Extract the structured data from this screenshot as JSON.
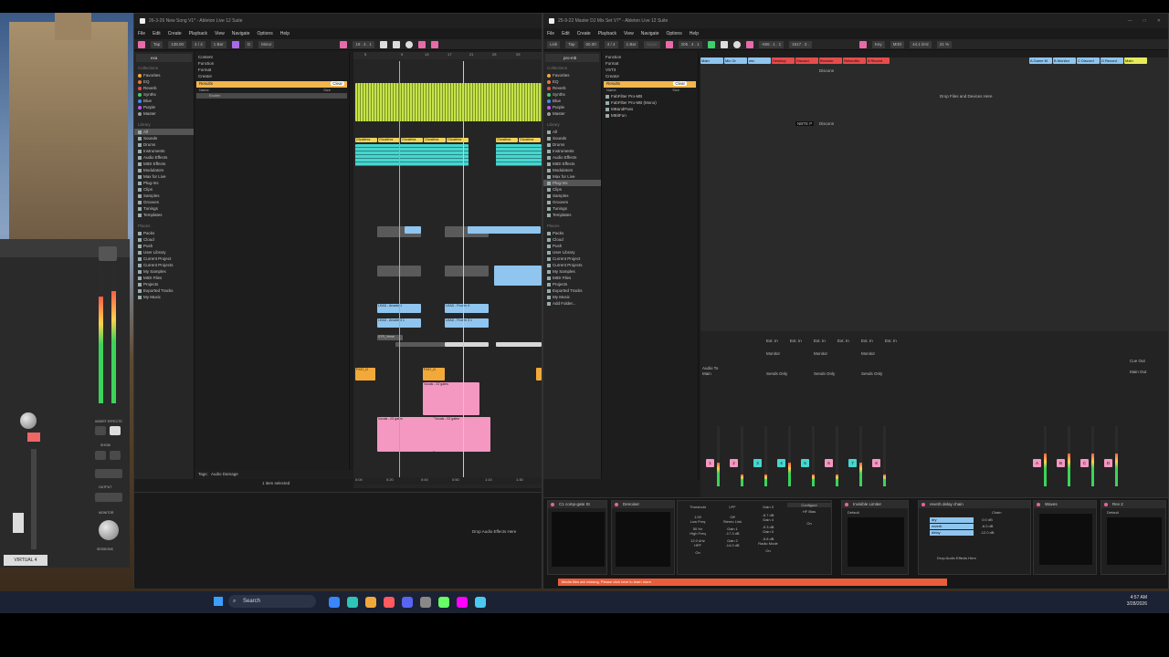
{
  "left_app": {
    "title": "26-3-26 New Song V1* - Ableton Live 12 Suite",
    "menu": [
      "File",
      "Edit",
      "Create",
      "Playback",
      "View",
      "Navigate",
      "Options",
      "Help"
    ],
    "toolbar": {
      "tap": "Tap",
      "bpm": "138.00",
      "signature": "4 / 4",
      "quant": "1 Bar",
      "key": "G",
      "scale": "Minor",
      "position": "19 . 4 . 1"
    },
    "search": {
      "value": "exa"
    },
    "filters": [
      "Content",
      "Function",
      "Format",
      "Creator"
    ],
    "results_header": "Results",
    "clear_label": "Clear",
    "name_col": "Name",
    "size_col": "Size",
    "result_item": "Exciter",
    "collections_title": "Collections",
    "collections": [
      {
        "label": "Favorites",
        "color": "#f2a93a"
      },
      {
        "label": "EQ",
        "color": "#e87a2e"
      },
      {
        "label": "Reverb",
        "color": "#e84b4b"
      },
      {
        "label": "Synths",
        "color": "#45c96c"
      },
      {
        "label": "Blue",
        "color": "#3d8fef"
      },
      {
        "label": "Purple",
        "color": "#b55be9"
      },
      {
        "label": "Master",
        "color": "#9a9a9a"
      }
    ],
    "library_title": "Library",
    "library": [
      "All",
      "Sounds",
      "Drums",
      "Instruments",
      "Audio Effects",
      "MIDI Effects",
      "Modulators",
      "Max for Live",
      "Plug-Ins",
      "Clips",
      "Samples",
      "Grooves",
      "Tunings",
      "Templates"
    ],
    "places_title": "Places",
    "places": [
      "Packs",
      "Cloud",
      "Push",
      "User Library",
      "Current Project",
      "Current Projects",
      "My Samples",
      "MIDI Files",
      "Projects",
      "Exported Tracks",
      "My Music"
    ],
    "ruler_marks": [
      "5",
      "9",
      "13",
      "17",
      "21",
      "25",
      "29"
    ],
    "time_marks": [
      "0:00",
      "0:20",
      "0:40",
      "0:50",
      "1:10",
      "1:30",
      "1:50"
    ],
    "clips": {
      "ghost": "Ghostfrea",
      "lead_a": "LEAD - Arcade 1",
      "lead_b": "LEAD - Frozen 3",
      "lead_c": "LEAD - Arcade 3 1",
      "lead_d": "LEAD - Frozen 3 1",
      "strings": "STR_Verse",
      "fx": "FX47_G",
      "vox1": "Vocals - 02 gates",
      "vox2": "Vocals - 02 gates",
      "vox3": "Vocals - 02 gates"
    },
    "tags": {
      "label": "Tags:",
      "value": "Audio Damage"
    },
    "status": "1 item selected"
  },
  "right_app": {
    "title": "25-9-22 Master DJ Mix Set V7* - Ableton Live 12 Suite",
    "menu": [
      "File",
      "Edit",
      "Create",
      "Playback",
      "View",
      "Navigate",
      "Options",
      "Help"
    ],
    "toolbar": {
      "link": "Link",
      "tap": "Tap",
      "bpm": "60.00",
      "signature": "4 / 4",
      "quant": "1 Bar",
      "key_mode": "Major",
      "position": "205 . 4 . 1",
      "pos2": "-655 . 1 . 1",
      "pos3": "1517 . 3 .",
      "key": "Key",
      "midi": "MIDI",
      "sample_rate": "44.1 kHz",
      "cpu": "21 %"
    },
    "search": {
      "value": "pro-mb"
    },
    "filters": [
      "Function",
      "Format",
      "VST3",
      "Creator"
    ],
    "results_header": "Results",
    "clear_label": "Clear",
    "name_col": "Name",
    "size_col": "Size",
    "results": [
      "FabFilter Pro-MB",
      "FabFilter Pro-MB (Mono)",
      "MBandPass",
      "MBitFun"
    ],
    "collections_title": "Collections",
    "collections": [
      {
        "label": "Favorites",
        "color": "#f2a93a"
      },
      {
        "label": "EQ",
        "color": "#e87a2e"
      },
      {
        "label": "Reverb",
        "color": "#e84b4b"
      },
      {
        "label": "Synths",
        "color": "#45c96c"
      },
      {
        "label": "Blue",
        "color": "#3d8fef"
      },
      {
        "label": "Purple",
        "color": "#b55be9"
      },
      {
        "label": "Master",
        "color": "#9a9a9a"
      }
    ],
    "library_title": "Library",
    "library": [
      "All",
      "Sounds",
      "Drums",
      "Instruments",
      "Audio Effects",
      "MIDI Effects",
      "Modulators",
      "Max for Live",
      "Plug-Ins",
      "Clips",
      "Samples",
      "Grooves",
      "Tunings",
      "Templates"
    ],
    "places_title": "Places",
    "places": [
      "Packs",
      "Cloud",
      "Push",
      "User Library",
      "Current Project",
      "Current Projects",
      "My Samples",
      "MIDI Files",
      "Projects",
      "Exported Tracks",
      "My Music",
      "Add Folder..."
    ],
    "tracks": [
      {
        "name": "Main",
        "color": "#8fc5ee"
      },
      {
        "name": "Mix Gr",
        "color": "#8fc5ee"
      },
      {
        "name": "mic",
        "color": "#8fc5ee"
      },
      {
        "name": "Desktop",
        "color": "#e84b4b"
      },
      {
        "name": "Discord",
        "color": "#e84b4b"
      },
      {
        "name": "Browser",
        "color": "#e84b4b"
      },
      {
        "name": "Rekordbo",
        "color": "#e84b4b"
      },
      {
        "name": "8 Record",
        "color": "#e84b4b"
      }
    ],
    "return_tracks": [
      {
        "name": "A Game M",
        "color": "#8fc5ee"
      },
      {
        "name": "B Monitor",
        "color": "#8fc5ee"
      },
      {
        "name": "C Discord",
        "color": "#8fc5ee"
      },
      {
        "name": "D Record",
        "color": "#8fc5ee"
      },
      {
        "name": "Main",
        "color": "#e7ea5c"
      }
    ],
    "clip_slot_text": {
      "disconn": "Disconn",
      "nbte": "NBTE P"
    },
    "drop_hint": "Drop Files and Devices Here",
    "channel_numbers": [
      "1",
      "2",
      "3",
      "4",
      "5",
      "6",
      "7",
      "8"
    ],
    "return_letters": [
      "A",
      "B",
      "C",
      "D"
    ],
    "io": {
      "audio_to": "Audio To",
      "main": "Main",
      "ext_in": "Ext. In",
      "sends_only": "Sends Only",
      "monitor": "Monitor",
      "in": "In",
      "auto": "Auto",
      "off": "Off",
      "cue_out": "Cue Out",
      "main_out": "Main Out",
      "io_12": "1/2"
    },
    "devices": [
      {
        "name": "C1 comp-gate St"
      },
      {
        "name": "Denoiser"
      },
      {
        "name": "Invisible Limiter"
      },
      {
        "name": "reverb delay chain"
      },
      {
        "name": "Waves"
      },
      {
        "name": "Rev 2"
      }
    ],
    "denoiser_params": {
      "threshold": "Threshold",
      "t_val": "1.00",
      "low_freq": "Low Freq",
      "lf_val": "50 Hz",
      "high_freq": "High Freq",
      "hf_val": "12.0 kHz",
      "hpf": "HPF",
      "off": "Off",
      "stereo_link": "Stereo Link",
      "lpf": "LPF",
      "gain1": "Gain 1",
      "g1": "-17.3 dB",
      "gain2": "Gain 2",
      "g2": "-14.0 dB",
      "gain3": "Gain 3",
      "g3": "-8.7 dB",
      "gain4": "Gain 4",
      "g4": "-5.3 dB",
      "gain5": "Gain 5",
      "g5": "-5.8 dB",
      "radio_mode": "Radio Mode",
      "on": "On"
    },
    "configure_label": "Configure",
    "hi_bias_label": "HF Bias",
    "default_label": "Default",
    "chain_label": "Chain",
    "chain_items": [
      "dry",
      "reverb",
      "delay"
    ],
    "chain_vals": [
      "0.0 dB",
      "-6.0 dB",
      "-12.0 dB"
    ],
    "drop_audio_effects": "Drop Audio Effects Here",
    "drop_audio_effects_right": "Drop Audio Effects Here",
    "warning": "Media files are missing. Please click here to learn more."
  },
  "ua_panel": {
    "label": "VIRTUAL 4",
    "insert_effects": "INSERT EFFECTS",
    "show": "SHOW",
    "output": "OUTPUT",
    "monitor": "MONITOR",
    "sessions": "SESSIONS"
  },
  "taskbar": {
    "search_placeholder": "Search",
    "time": "4:57 AM",
    "date": "3/28/2026",
    "icons": [
      "start-icon",
      "search-icon",
      "task-view-icon",
      "files-icon",
      "edge-icon",
      "chrome-icon",
      "discord-icon",
      "terminal-icon",
      "settings-icon",
      "store-icon",
      "mail-icon"
    ]
  }
}
